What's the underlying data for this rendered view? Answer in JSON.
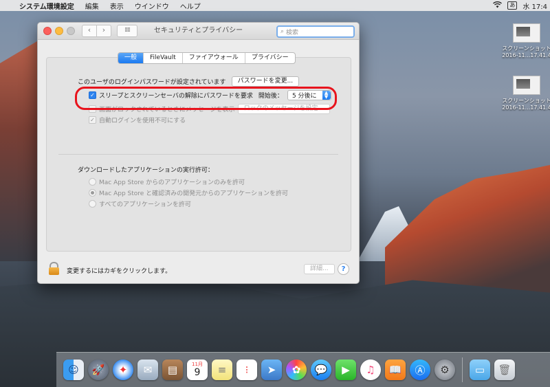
{
  "menubar": {
    "app_name": "システム環境設定",
    "items": [
      "編集",
      "表示",
      "ウインドウ",
      "ヘルプ"
    ],
    "input_badge": "あ",
    "clock": "水 17:4"
  },
  "desktop_icons": [
    {
      "name": "スクリーンショット",
      "date": "2016-11...17.41.4"
    },
    {
      "name": "スクリーンショット",
      "date": "2016-11...17.41.4"
    }
  ],
  "window": {
    "title": "セキュリティとプライバシー",
    "search_placeholder": "検索",
    "nav_back": "‹",
    "nav_forward": "›",
    "grid_glyph": "⁞⁞⁞⁞"
  },
  "tabs": [
    {
      "label": "一般",
      "active": true
    },
    {
      "label": "FileVault",
      "active": false
    },
    {
      "label": "ファイアウォール",
      "active": false
    },
    {
      "label": "プライバシー",
      "active": false
    }
  ],
  "general": {
    "password_label": "このユーザのログインパスワードが設定されています",
    "change_password_button": "パスワードを変更...",
    "require_password_label": "スリープとスクリーンセーバの解除にパスワードを要求",
    "start_after_label": "開始後：",
    "start_after_value": "5 分後に",
    "show_message_label": "画面がロックされているときにメッセージを表示",
    "set_lock_message_button": "ロックのメッセージを設定...",
    "disable_autologin_label": "自動ログインを使用不可にする",
    "downloads_heading": "ダウンロードしたアプリケーションの実行許可：",
    "radio_options": [
      {
        "label": "Mac App Store からのアプリケーションのみを許可",
        "selected": false
      },
      {
        "label": "Mac App Store と確認済みの開発元からのアプリケーションを許可",
        "selected": true
      },
      {
        "label": "すべてのアプリケーションを許可",
        "selected": false
      }
    ]
  },
  "footer": {
    "lock_text": "変更するにはカギをクリックします。",
    "advanced_button": "詳細...",
    "help": "?"
  },
  "dock": {
    "calendar_month": "11月",
    "calendar_day": "9"
  },
  "colors": {
    "accent": "#1b7af1",
    "highlight": "#e8141d"
  }
}
